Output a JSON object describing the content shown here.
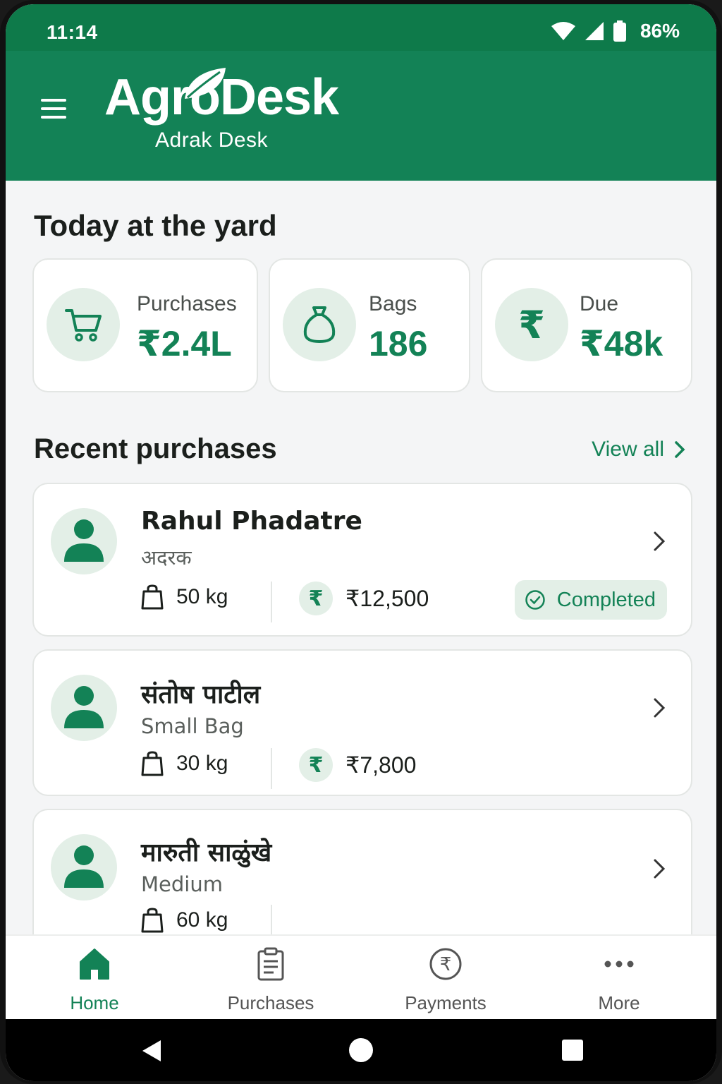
{
  "status_bar": {
    "time": "11:14",
    "battery": "86%"
  },
  "app_bar": {
    "brand": "AgroDesk",
    "subtitle": "Adrak Desk"
  },
  "today": {
    "title": "Today at the yard",
    "cards": [
      {
        "label": "Purchases",
        "value": "₹2.4L",
        "icon": "cart-icon"
      },
      {
        "label": "Bags",
        "value": "186",
        "icon": "bag-icon"
      },
      {
        "label": "Due",
        "value": "₹48k",
        "icon": "rupee-icon"
      }
    ]
  },
  "recent": {
    "title": "Recent purchases",
    "view_all": "View all",
    "items": [
      {
        "name": "Rahul Phadatre",
        "sub": "अदरक",
        "weight": "50 kg",
        "amount": "₹12,500",
        "status": "Completed"
      },
      {
        "name": "संतोष पाटील",
        "sub": "Small Bag",
        "weight": "30 kg",
        "amount": "₹7,800"
      },
      {
        "name": "मारुती साळुंखे",
        "sub": "Medium",
        "weight": "60 kg"
      }
    ]
  },
  "bottom_nav": [
    {
      "label": "Home",
      "icon": "home-icon",
      "active": true
    },
    {
      "label": "Purchases",
      "icon": "clipboard-icon"
    },
    {
      "label": "Payments",
      "icon": "rupee-circle-icon"
    },
    {
      "label": "More",
      "icon": "more-dots-icon"
    }
  ],
  "colors": {
    "brand_green": "#138256",
    "status_green": "#0e7a4a",
    "tint": "#e3efe7"
  }
}
